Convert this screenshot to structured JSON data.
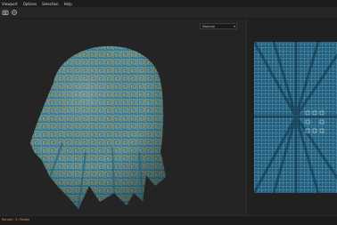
{
  "menu": {
    "items": [
      "Viewport",
      "Options",
      "Selection",
      "Help"
    ]
  },
  "toolbar": {
    "icons": [
      "camera-icon",
      "settings-icon"
    ]
  },
  "viewport": {
    "object": "draped-cloth",
    "pattern": "greek-key",
    "colors": {
      "background": "#242424",
      "fabric": "#2f7fa8",
      "fabric_shadow": "#1d5878",
      "pattern": "#b59a56"
    }
  },
  "material_select": {
    "value": "Material"
  },
  "texture_preview": {
    "name": "radial-pattern-texture"
  },
  "status": {
    "text": "Render: 3 / Ready"
  }
}
